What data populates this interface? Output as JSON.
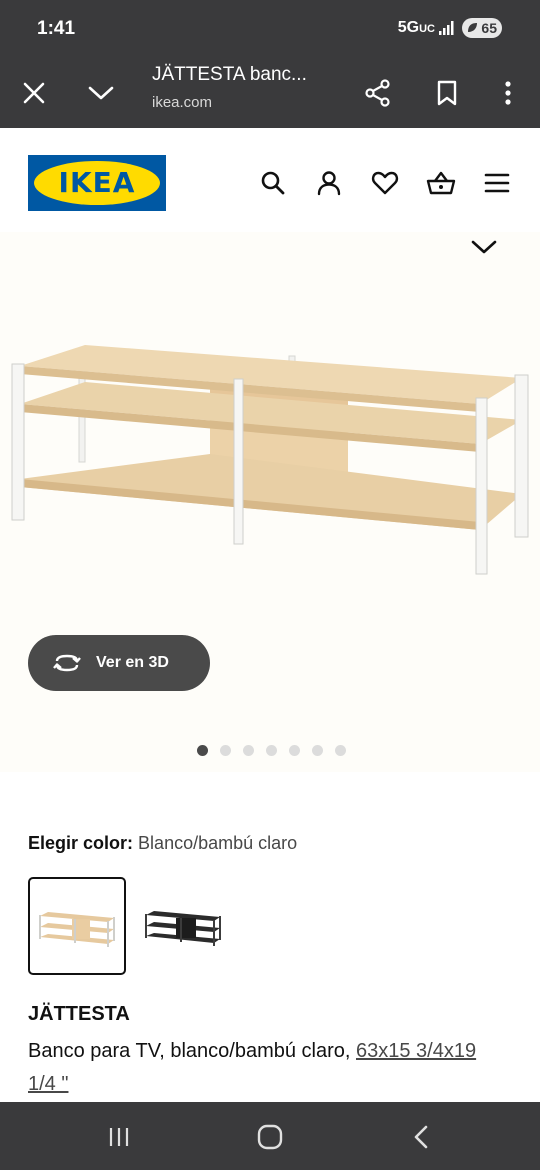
{
  "status_bar": {
    "time": "1:41",
    "network": "5G",
    "network_sub": "UC",
    "battery": "65"
  },
  "browser": {
    "title": "JÄTTESTA banc...",
    "url": "ikea.com"
  },
  "header": {
    "logo_text": "IKEA"
  },
  "gallery": {
    "view_3d_label": "Ver en 3D",
    "image_count": 7,
    "active_index": 0
  },
  "color_selector": {
    "label": "Elegir color:",
    "value": "Blanco/bambú claro"
  },
  "product": {
    "name": "JÄTTESTA",
    "description": "Banco para TV, blanco/bambú claro,",
    "dimensions": "63x15 3/4x19 1/4 \""
  },
  "colors": {
    "chrome": "#3a3a3c",
    "ikea_blue": "#0058a3",
    "ikea_yellow": "#ffdb00",
    "wood": "#e8cfa5"
  }
}
